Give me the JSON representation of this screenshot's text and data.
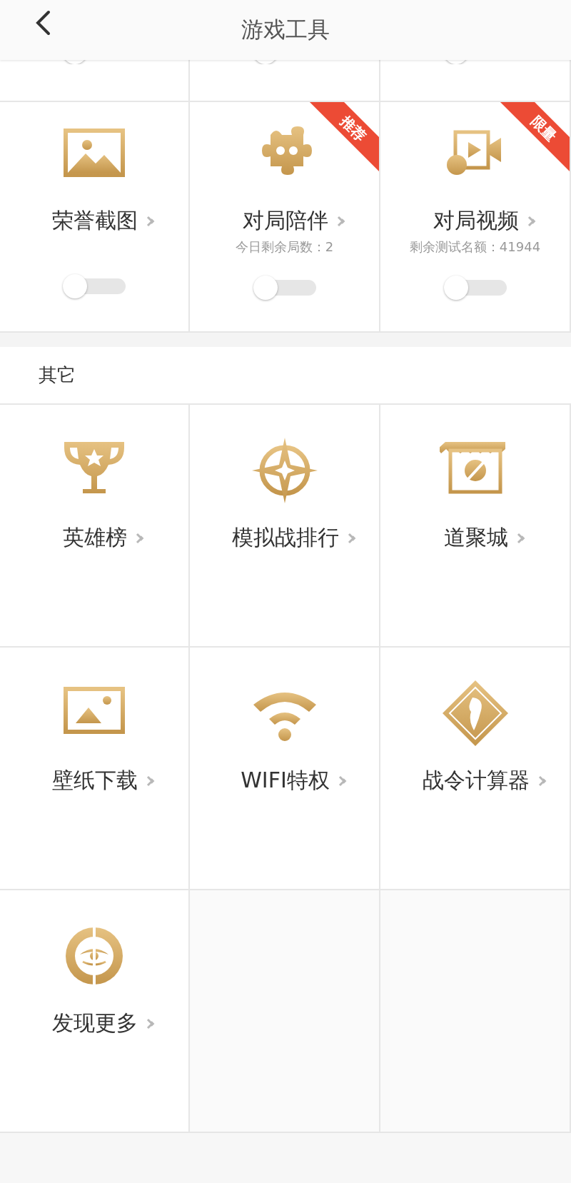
{
  "header": {
    "title": "游戏工具"
  },
  "top_row": [
    {
      "toggle": {
        "on": false
      }
    },
    {
      "toggle": {
        "on": false
      }
    },
    {
      "toggle": {
        "on": false
      }
    }
  ],
  "tools": [
    {
      "label": "荣誉截图",
      "toggle": {
        "on": false
      }
    },
    {
      "label": "对局陪伴",
      "subtitle": "今日剩余局数：2",
      "ribbon": "推荐",
      "toggle": {
        "on": false
      }
    },
    {
      "label": "对局视频",
      "subtitle": "剩余测试名额：41944",
      "ribbon": "限量",
      "toggle": {
        "on": false
      }
    }
  ],
  "section": {
    "title": "其它"
  },
  "others": [
    {
      "label": "英雄榜"
    },
    {
      "label": "模拟战排行"
    },
    {
      "label": "道聚城"
    },
    {
      "label": "壁纸下载"
    },
    {
      "label": "WIFI特权"
    },
    {
      "label": "战令计算器"
    },
    {
      "label": "发现更多"
    }
  ]
}
